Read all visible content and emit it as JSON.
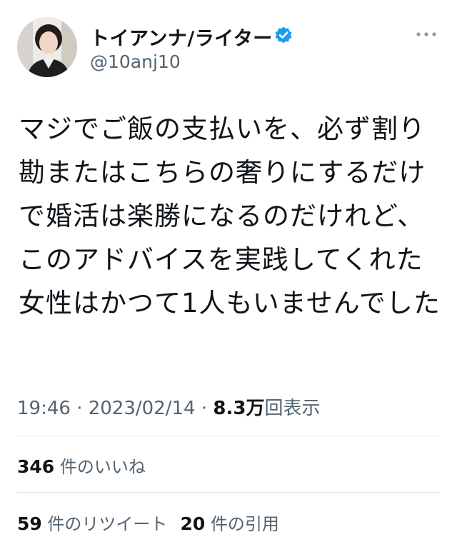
{
  "author": {
    "name": "トイアンナ/ライター",
    "handle": "@10anj10",
    "verified": true,
    "avatar_icon": "person-portrait-icon",
    "verified_icon": "verified-badge-icon",
    "verified_color": "#1d9bf0"
  },
  "more_icon": "more-options-icon",
  "tweet": {
    "text": "マジでご飯の支払いを、必ず割り勘またはこちらの奢りにするだけで婚活は楽勝になるのだけれど、このアドバイスを実践してくれた女性はかつて1人もいませんでした"
  },
  "meta": {
    "time": "19:46",
    "separator1": " · ",
    "date": "2023/02/14",
    "separator2": " · ",
    "views_count": "8.3万",
    "views_label": "回表示"
  },
  "stats": {
    "likes_count": "346",
    "likes_label": "件のいいね",
    "retweets_count": "59",
    "retweets_label": "件のリツイート",
    "quotes_count": "20",
    "quotes_label": "件の引用"
  },
  "colors": {
    "text_primary": "#0f1419",
    "text_secondary": "#536471",
    "divider": "#dfe3e7"
  }
}
